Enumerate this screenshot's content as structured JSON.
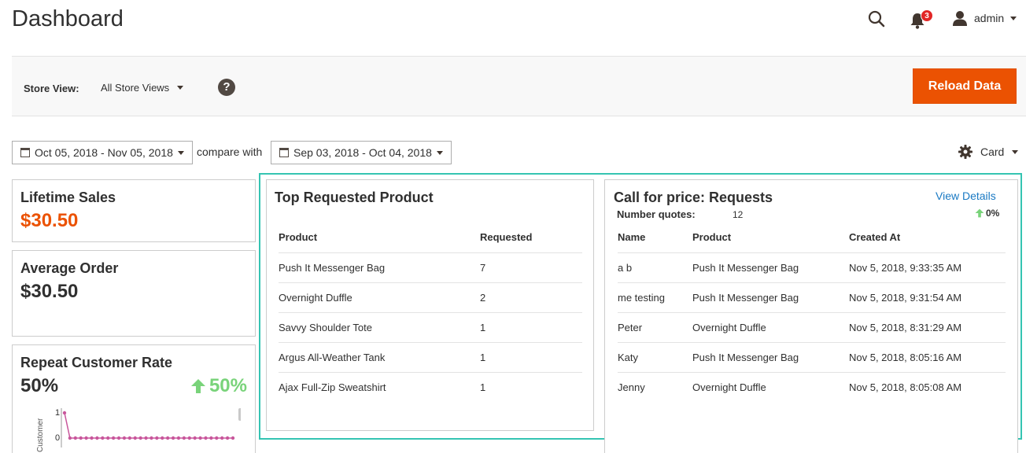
{
  "header": {
    "title": "Dashboard",
    "notification_count": "3",
    "user_name": "admin"
  },
  "store_view": {
    "label": "Store View:",
    "selected": "All Store Views",
    "help_glyph": "?",
    "reload_label": "Reload Data"
  },
  "dates": {
    "range": "Oct 05, 2018 - Nov 05, 2018",
    "compare_label": "compare with",
    "compare_range": "Sep 03, 2018 - Oct 04, 2018",
    "view_mode": "Card"
  },
  "stats": {
    "lifetime_sales": {
      "title": "Lifetime Sales",
      "value": "$30.50"
    },
    "average_order": {
      "title": "Average Order",
      "value": "$30.50"
    },
    "repeat_customer": {
      "title": "Repeat Customer Rate",
      "value": "50%",
      "change": "50%"
    }
  },
  "mini_chart": {
    "ylabel": "Customer",
    "yticks": [
      "1",
      "0"
    ],
    "values": [
      1,
      0,
      0,
      0,
      0,
      0,
      0,
      0,
      0,
      0,
      0,
      0,
      0,
      0,
      0,
      0,
      0,
      0,
      0,
      0,
      0,
      0,
      0,
      0,
      0,
      0,
      0,
      0,
      0,
      0,
      0,
      0
    ],
    "color": "#c8569b"
  },
  "top_requested": {
    "title": "Top Requested Product",
    "columns": [
      "Product",
      "Requested"
    ],
    "rows": [
      [
        "Push It Messenger Bag",
        "7"
      ],
      [
        "Overnight Duffle",
        "2"
      ],
      [
        "Savvy Shoulder Tote",
        "1"
      ],
      [
        "Argus All-Weather Tank",
        "1"
      ],
      [
        "Ajax Full-Zip Sweatshirt",
        "1"
      ]
    ]
  },
  "call_for_price": {
    "title": "Call for price: Requests",
    "view_details": "View Details",
    "quotes_label": "Number quotes:",
    "quotes_value": "12",
    "change": "0%",
    "columns": [
      "Name",
      "Product",
      "Created At"
    ],
    "rows": [
      [
        "a b",
        "Push It Messenger Bag",
        "Nov 5, 2018, 9:33:35 AM"
      ],
      [
        "me testing",
        "Push It Messenger Bag",
        "Nov 5, 2018, 9:31:54 AM"
      ],
      [
        "Peter",
        "Overnight Duffle",
        "Nov 5, 2018, 8:31:29 AM"
      ],
      [
        "Katy",
        "Push It Messenger Bag",
        "Nov 5, 2018, 8:05:16 AM"
      ],
      [
        "Jenny",
        "Overnight Duffle",
        "Nov 5, 2018, 8:05:08 AM"
      ]
    ]
  },
  "colors": {
    "accent": "#eb5202",
    "positive": "#79d37a",
    "link": "#1979c3",
    "highlight": "#35c4b2"
  }
}
